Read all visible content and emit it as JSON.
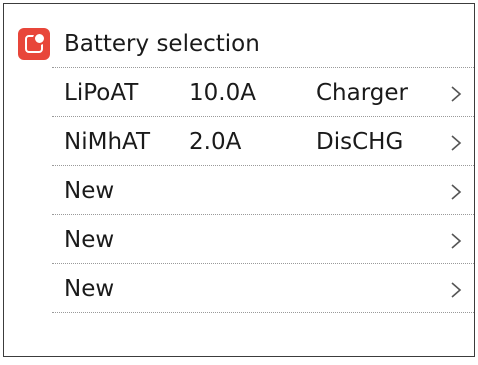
{
  "header": {
    "title": "Battery selection",
    "icon": "battery-app-icon"
  },
  "colors": {
    "accent": "#e8463a",
    "divider": "#9a9a9a",
    "text": "#1a1a1a",
    "chevron": "#555555"
  },
  "rows": [
    {
      "name": "LiPoAT",
      "current": "10.0A",
      "mode": "Charger",
      "icon": "chevron-right-icon"
    },
    {
      "name": "NiMhAT",
      "current": "2.0A",
      "mode": "DisCHG",
      "icon": "chevron-right-icon"
    },
    {
      "name": "New",
      "current": "",
      "mode": "",
      "icon": "chevron-right-icon"
    },
    {
      "name": "New",
      "current": "",
      "mode": "",
      "icon": "chevron-right-icon"
    },
    {
      "name": "New",
      "current": "",
      "mode": "",
      "icon": "chevron-right-icon"
    }
  ]
}
